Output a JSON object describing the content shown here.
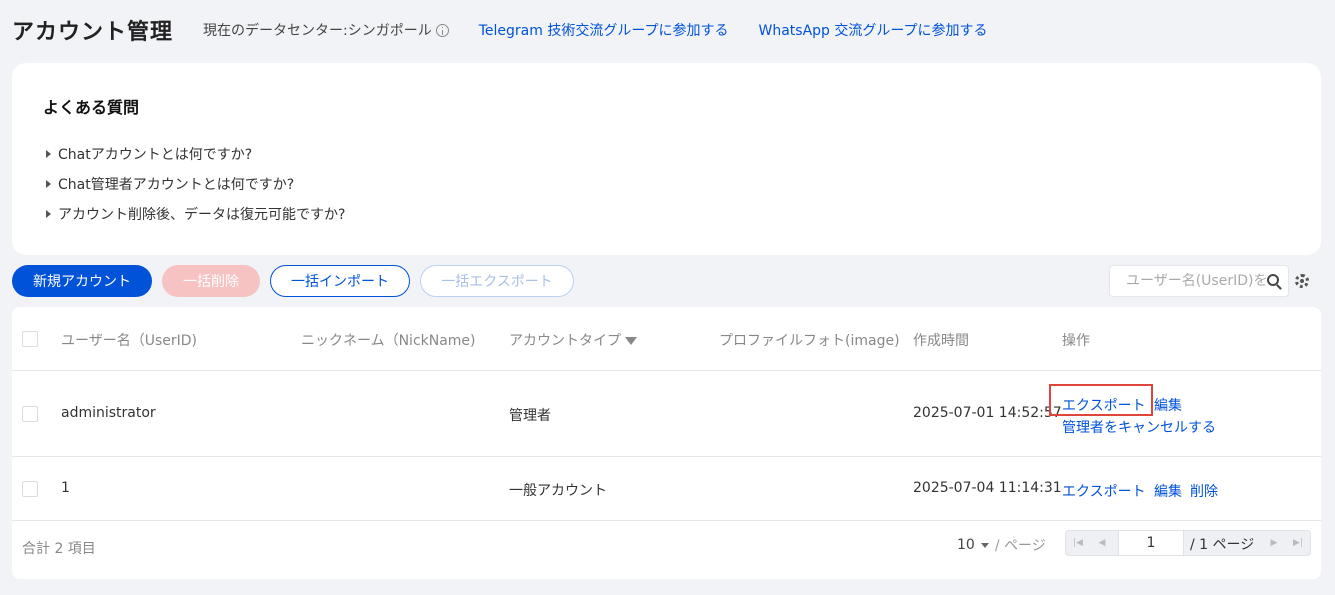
{
  "header": {
    "title": "アカウント管理",
    "datacenter_label": "現在のデータセンター:シンガポール",
    "telegram_link": "Telegram 技術交流グループに参加する",
    "whatsapp_link": "WhatsApp 交流グループに参加する"
  },
  "faq": {
    "title": "よくある質問",
    "items": [
      "Chatアカウントとは何ですか?",
      "Chat管理者アカウントとは何ですか?",
      "アカウント削除後、データは復元可能ですか?"
    ]
  },
  "toolbar": {
    "new_account": "新規アカウント",
    "bulk_delete": "一括削除",
    "bulk_import": "一括インポート",
    "bulk_export": "一括エクスポート",
    "search_placeholder": "ユーザー名(UserID)を検索"
  },
  "table": {
    "columns": [
      "ユーザー名（UserID)",
      "ニックネーム（NickName)",
      "アカウントタイプ",
      "プロファイルフォト(image)",
      "作成時間",
      "操作"
    ],
    "rows": [
      {
        "userid": "administrator",
        "nickname": "",
        "type": "管理者",
        "image": "",
        "created": "2025-07-01 14:52:57",
        "actions": [
          "エクスポート",
          "編集",
          "管理者をキャンセルする"
        ]
      },
      {
        "userid": "1",
        "nickname": "",
        "type": "一般アカウント",
        "image": "",
        "created": "2025-07-04 11:14:31",
        "actions": [
          "エクスポート",
          "編集",
          "削除"
        ]
      }
    ]
  },
  "footer": {
    "total": "合計 2 項目",
    "page_size": "10",
    "per_page": "/ ページ",
    "current_page": "1",
    "total_pages": "/ 1 ページ"
  },
  "colors": {
    "accent": "#0052d9",
    "highlight": "#e0453b",
    "disabled_danger": "#f6c2c2"
  }
}
